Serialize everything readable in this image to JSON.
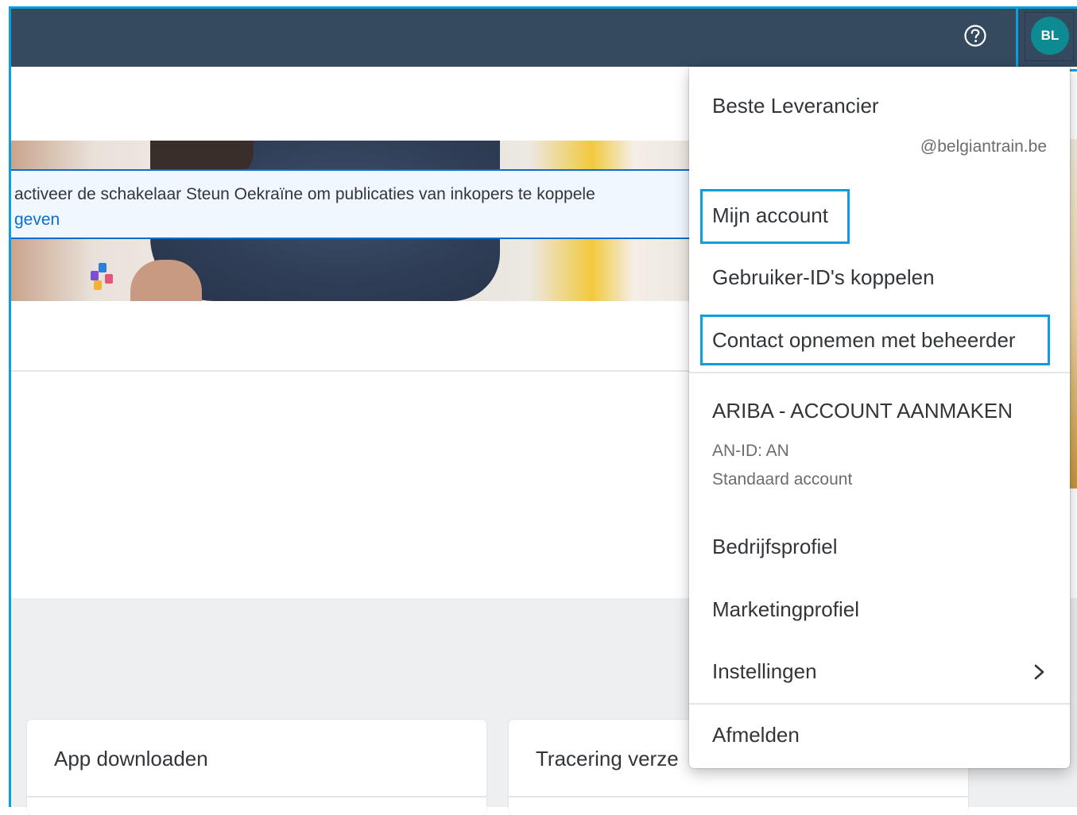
{
  "header": {
    "help_icon": "question-circle-icon",
    "avatar_initials": "BL"
  },
  "banner": {
    "notice_text": "activeer de schakelaar Steun Oekraïne om publicaties van inkopers te koppele",
    "notice_link": "geven"
  },
  "cards": [
    {
      "title": "App downloaden"
    },
    {
      "title": "Tracering verze"
    }
  ],
  "user_menu": {
    "user_name": "Beste Leverancier",
    "user_email": "@belgiantrain.be",
    "items": [
      {
        "label": "Mijn account"
      },
      {
        "label": "Gebruiker-ID's koppelen"
      },
      {
        "label": "Contact opnemen met beheerder"
      }
    ],
    "company": {
      "name": "ARIBA - ACCOUNT AANMAKEN",
      "an_id": "AN-ID: AN",
      "account_type": "Standaard account"
    },
    "company_items": [
      {
        "label": "Bedrijfsprofiel"
      },
      {
        "label": "Marketingprofiel"
      },
      {
        "label": "Instellingen",
        "icon": "chevron-right-icon"
      }
    ],
    "logout": "Afmelden"
  },
  "colors": {
    "header_bg": "#354a5f",
    "highlight": "#0a9ee0",
    "link": "#0a6ed1",
    "avatar_bg": "#0e8a92"
  }
}
